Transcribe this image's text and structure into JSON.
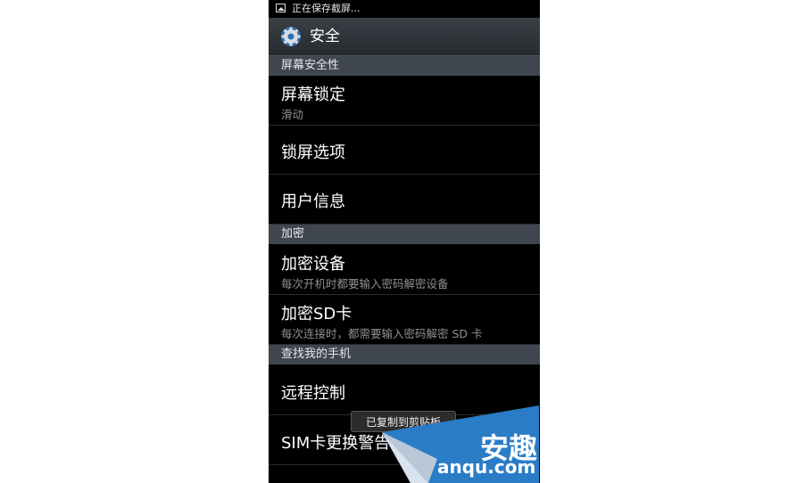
{
  "status_bar": {
    "text": "正在保存截屏..."
  },
  "title_bar": {
    "title": "安全"
  },
  "sections": [
    {
      "header": "屏幕安全性"
    },
    {
      "header": "加密"
    },
    {
      "header": "查找我的手机"
    }
  ],
  "items": [
    {
      "title": "屏幕锁定",
      "subtitle": "滑动"
    },
    {
      "title": "锁屏选项"
    },
    {
      "title": "用户信息"
    },
    {
      "title": "加密设备",
      "subtitle": "每次开机时都要输入密码解密设备"
    },
    {
      "title": "加密SD卡",
      "subtitle": "每次连接时，都需要输入密码解密 SD 卡"
    },
    {
      "title": "远程控制"
    },
    {
      "title": "SIM卡更换警告"
    }
  ],
  "toast": {
    "text": "已复制到剪贴板"
  },
  "watermark": {
    "cn": "安趣",
    "domain": "anqu.com"
  }
}
